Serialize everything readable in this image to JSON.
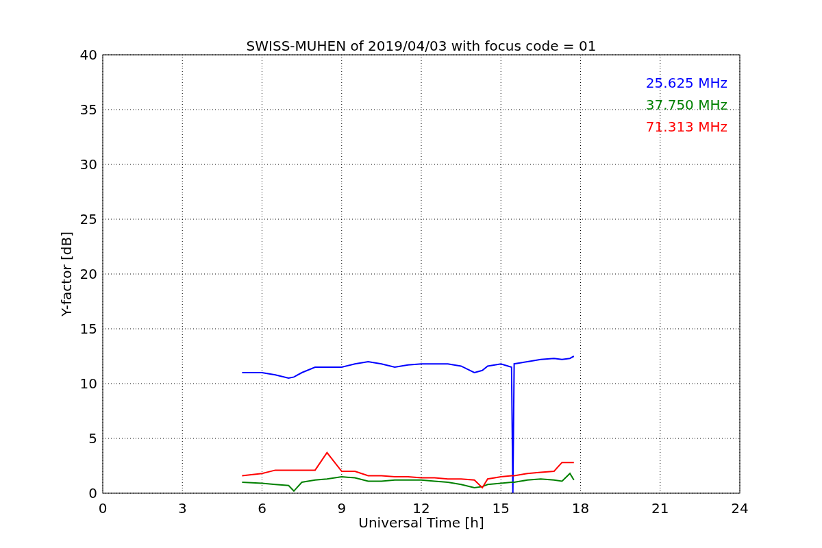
{
  "chart_data": {
    "type": "line",
    "title": "SWISS-MUHEN of 2019/04/03 with focus code = 01",
    "xlabel": "Universal Time [h]",
    "ylabel": "Y-factor [dB]",
    "x": [
      5.25,
      6,
      6.5,
      7,
      7.2,
      7.5,
      8,
      8.45,
      9,
      9.5,
      10,
      10.5,
      11,
      11.5,
      12,
      12.5,
      13,
      13.5,
      14,
      14.3,
      14.5,
      15,
      15.4,
      15.45,
      15.5,
      16,
      16.5,
      17,
      17.3,
      17.6,
      17.75
    ],
    "series": [
      {
        "name": "25.625 MHz",
        "color": "#0000ff",
        "values": [
          11,
          11,
          10.8,
          10.5,
          10.6,
          11,
          11.5,
          11.5,
          11.5,
          11.8,
          12,
          11.8,
          11.5,
          11.7,
          11.8,
          11.8,
          11.8,
          11.6,
          11,
          11.2,
          11.6,
          11.8,
          11.5,
          0,
          11.8,
          12,
          12.2,
          12.3,
          12.2,
          12.3,
          12.5
        ]
      },
      {
        "name": "37.750 MHz",
        "color": "#008000",
        "values": [
          1,
          0.9,
          0.8,
          0.7,
          0.2,
          1,
          1.2,
          1.3,
          1.5,
          1.4,
          1.1,
          1.1,
          1.2,
          1.2,
          1.2,
          1.1,
          1,
          0.8,
          0.5,
          0.6,
          0.8,
          0.9,
          1,
          1,
          1,
          1.2,
          1.3,
          1.2,
          1.1,
          1.8,
          1.2
        ]
      },
      {
        "name": "71.313 MHz",
        "color": "#ff0000",
        "values": [
          1.6,
          1.8,
          2.1,
          2.1,
          2.1,
          2.1,
          2.1,
          3.7,
          2,
          2,
          1.6,
          1.6,
          1.5,
          1.5,
          1.4,
          1.4,
          1.3,
          1.3,
          1.2,
          0.5,
          1.3,
          1.5,
          1.6,
          1.6,
          1.6,
          1.8,
          1.9,
          2,
          2.8,
          2.8,
          2.8
        ]
      }
    ],
    "grid": true,
    "xlim": [
      0,
      24
    ],
    "ylim": [
      0,
      40
    ],
    "xticks": [
      0,
      3,
      6,
      9,
      12,
      15,
      18,
      21,
      24
    ],
    "yticks": [
      0,
      5,
      10,
      15,
      20,
      25,
      30,
      35,
      40
    ]
  }
}
